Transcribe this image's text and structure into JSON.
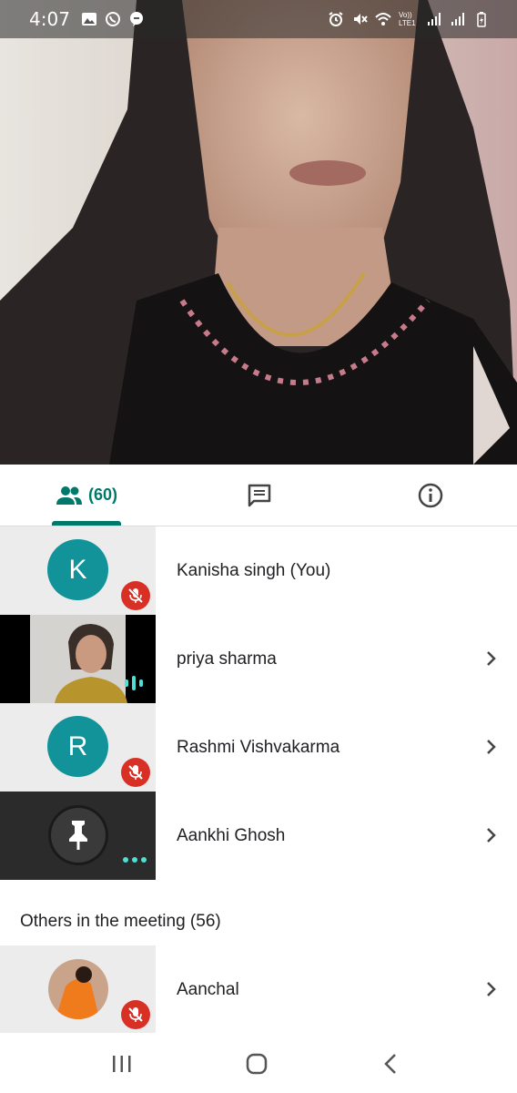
{
  "status_bar": {
    "time": "4:07",
    "left_icons": [
      "gallery-icon",
      "whatsapp-icon",
      "chat-icon"
    ],
    "right_icons": [
      "alarm-icon",
      "mute-icon",
      "wifi-icon",
      "volte-icon",
      "signal-icon",
      "signal-icon",
      "battery-icon"
    ],
    "volte_label": "Vo)) LTE1"
  },
  "tabs": {
    "people_count": "(60)",
    "chat_icon": "chat-icon",
    "info_icon": "info-icon",
    "active": "people"
  },
  "participants": [
    {
      "name": "Kanisha singh (You)",
      "avatar": "K",
      "muted": true,
      "chevron": false
    },
    {
      "name": "priya sharma",
      "avatar": "video",
      "muted": false,
      "speaking": true,
      "chevron": true
    },
    {
      "name": "Rashmi Vishvakarma",
      "avatar": "R",
      "muted": true,
      "chevron": true
    },
    {
      "name": "Aankhi Ghosh",
      "avatar": "pinned",
      "muted": false,
      "more": true,
      "chevron": true
    }
  ],
  "others_heading": "Others in the meeting (56)",
  "others": [
    {
      "name": "Aanchal",
      "avatar": "photo",
      "muted": true,
      "chevron": true
    }
  ],
  "colors": {
    "accent": "#00796b",
    "avatar_teal": "#12939a",
    "mute_red": "#d93025"
  }
}
